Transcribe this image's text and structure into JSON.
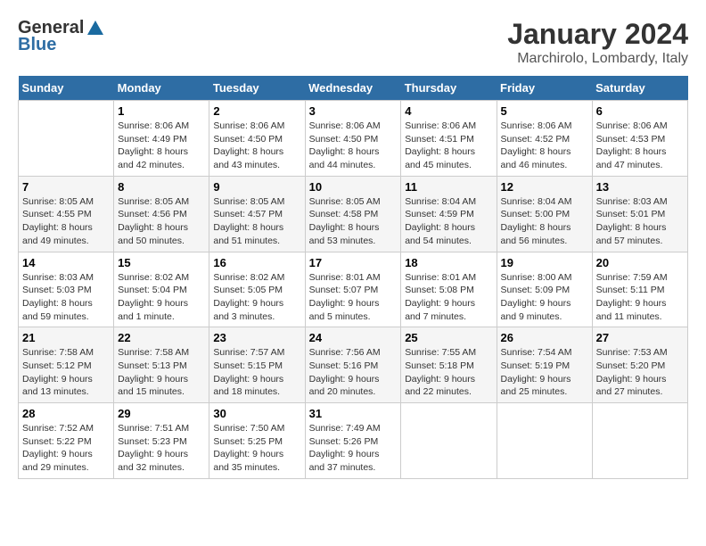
{
  "logo": {
    "general": "General",
    "blue": "Blue"
  },
  "title": "January 2024",
  "subtitle": "Marchirolo, Lombardy, Italy",
  "days_of_week": [
    "Sunday",
    "Monday",
    "Tuesday",
    "Wednesday",
    "Thursday",
    "Friday",
    "Saturday"
  ],
  "weeks": [
    [
      {
        "day": "",
        "info": ""
      },
      {
        "day": "1",
        "info": "Sunrise: 8:06 AM\nSunset: 4:49 PM\nDaylight: 8 hours\nand 42 minutes."
      },
      {
        "day": "2",
        "info": "Sunrise: 8:06 AM\nSunset: 4:50 PM\nDaylight: 8 hours\nand 43 minutes."
      },
      {
        "day": "3",
        "info": "Sunrise: 8:06 AM\nSunset: 4:50 PM\nDaylight: 8 hours\nand 44 minutes."
      },
      {
        "day": "4",
        "info": "Sunrise: 8:06 AM\nSunset: 4:51 PM\nDaylight: 8 hours\nand 45 minutes."
      },
      {
        "day": "5",
        "info": "Sunrise: 8:06 AM\nSunset: 4:52 PM\nDaylight: 8 hours\nand 46 minutes."
      },
      {
        "day": "6",
        "info": "Sunrise: 8:06 AM\nSunset: 4:53 PM\nDaylight: 8 hours\nand 47 minutes."
      }
    ],
    [
      {
        "day": "7",
        "info": "Sunrise: 8:05 AM\nSunset: 4:55 PM\nDaylight: 8 hours\nand 49 minutes."
      },
      {
        "day": "8",
        "info": "Sunrise: 8:05 AM\nSunset: 4:56 PM\nDaylight: 8 hours\nand 50 minutes."
      },
      {
        "day": "9",
        "info": "Sunrise: 8:05 AM\nSunset: 4:57 PM\nDaylight: 8 hours\nand 51 minutes."
      },
      {
        "day": "10",
        "info": "Sunrise: 8:05 AM\nSunset: 4:58 PM\nDaylight: 8 hours\nand 53 minutes."
      },
      {
        "day": "11",
        "info": "Sunrise: 8:04 AM\nSunset: 4:59 PM\nDaylight: 8 hours\nand 54 minutes."
      },
      {
        "day": "12",
        "info": "Sunrise: 8:04 AM\nSunset: 5:00 PM\nDaylight: 8 hours\nand 56 minutes."
      },
      {
        "day": "13",
        "info": "Sunrise: 8:03 AM\nSunset: 5:01 PM\nDaylight: 8 hours\nand 57 minutes."
      }
    ],
    [
      {
        "day": "14",
        "info": "Sunrise: 8:03 AM\nSunset: 5:03 PM\nDaylight: 8 hours\nand 59 minutes."
      },
      {
        "day": "15",
        "info": "Sunrise: 8:02 AM\nSunset: 5:04 PM\nDaylight: 9 hours\nand 1 minute."
      },
      {
        "day": "16",
        "info": "Sunrise: 8:02 AM\nSunset: 5:05 PM\nDaylight: 9 hours\nand 3 minutes."
      },
      {
        "day": "17",
        "info": "Sunrise: 8:01 AM\nSunset: 5:07 PM\nDaylight: 9 hours\nand 5 minutes."
      },
      {
        "day": "18",
        "info": "Sunrise: 8:01 AM\nSunset: 5:08 PM\nDaylight: 9 hours\nand 7 minutes."
      },
      {
        "day": "19",
        "info": "Sunrise: 8:00 AM\nSunset: 5:09 PM\nDaylight: 9 hours\nand 9 minutes."
      },
      {
        "day": "20",
        "info": "Sunrise: 7:59 AM\nSunset: 5:11 PM\nDaylight: 9 hours\nand 11 minutes."
      }
    ],
    [
      {
        "day": "21",
        "info": "Sunrise: 7:58 AM\nSunset: 5:12 PM\nDaylight: 9 hours\nand 13 minutes."
      },
      {
        "day": "22",
        "info": "Sunrise: 7:58 AM\nSunset: 5:13 PM\nDaylight: 9 hours\nand 15 minutes."
      },
      {
        "day": "23",
        "info": "Sunrise: 7:57 AM\nSunset: 5:15 PM\nDaylight: 9 hours\nand 18 minutes."
      },
      {
        "day": "24",
        "info": "Sunrise: 7:56 AM\nSunset: 5:16 PM\nDaylight: 9 hours\nand 20 minutes."
      },
      {
        "day": "25",
        "info": "Sunrise: 7:55 AM\nSunset: 5:18 PM\nDaylight: 9 hours\nand 22 minutes."
      },
      {
        "day": "26",
        "info": "Sunrise: 7:54 AM\nSunset: 5:19 PM\nDaylight: 9 hours\nand 25 minutes."
      },
      {
        "day": "27",
        "info": "Sunrise: 7:53 AM\nSunset: 5:20 PM\nDaylight: 9 hours\nand 27 minutes."
      }
    ],
    [
      {
        "day": "28",
        "info": "Sunrise: 7:52 AM\nSunset: 5:22 PM\nDaylight: 9 hours\nand 29 minutes."
      },
      {
        "day": "29",
        "info": "Sunrise: 7:51 AM\nSunset: 5:23 PM\nDaylight: 9 hours\nand 32 minutes."
      },
      {
        "day": "30",
        "info": "Sunrise: 7:50 AM\nSunset: 5:25 PM\nDaylight: 9 hours\nand 35 minutes."
      },
      {
        "day": "31",
        "info": "Sunrise: 7:49 AM\nSunset: 5:26 PM\nDaylight: 9 hours\nand 37 minutes."
      },
      {
        "day": "",
        "info": ""
      },
      {
        "day": "",
        "info": ""
      },
      {
        "day": "",
        "info": ""
      }
    ]
  ]
}
